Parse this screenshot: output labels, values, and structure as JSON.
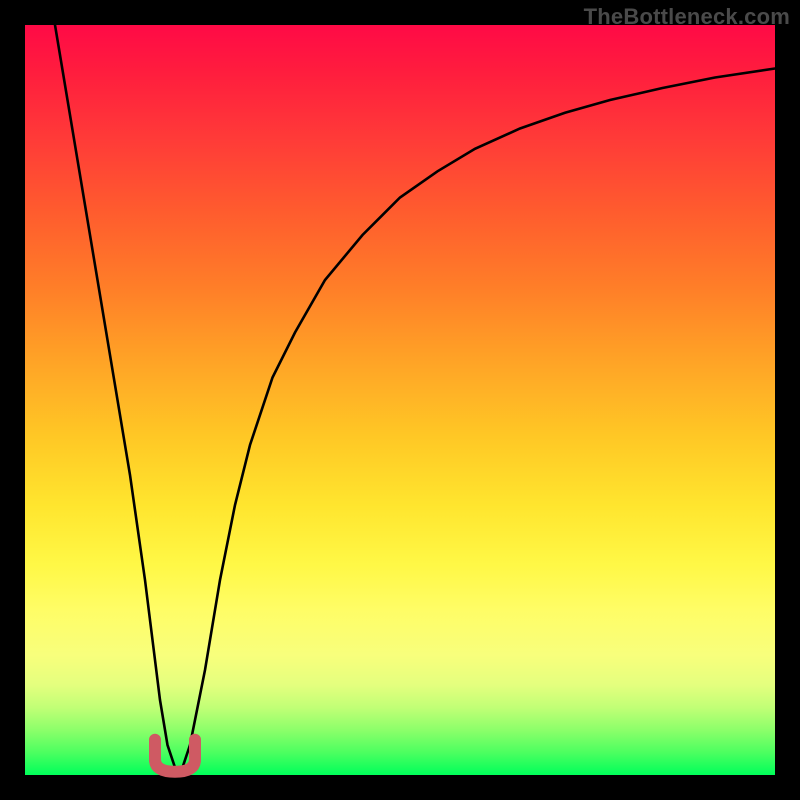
{
  "watermark": "TheBottleneck.com",
  "chart_data": {
    "type": "line",
    "title": "",
    "xlabel": "",
    "ylabel": "",
    "xlim": [
      0,
      100
    ],
    "ylim": [
      0,
      100
    ],
    "grid": false,
    "legend": null,
    "series": [
      {
        "name": "bottleneck-curve",
        "x": [
          4,
          6,
          8,
          10,
          12,
          14,
          16,
          17,
          18,
          19,
          20,
          21,
          22,
          24,
          26,
          28,
          30,
          33,
          36,
          40,
          45,
          50,
          55,
          60,
          66,
          72,
          78,
          85,
          92,
          100
        ],
        "y": [
          100,
          88,
          76,
          64,
          52,
          40,
          26,
          18,
          10,
          4,
          1,
          1,
          4,
          14,
          26,
          36,
          44,
          53,
          59,
          66,
          72,
          77,
          80.5,
          83.5,
          86.2,
          88.3,
          90,
          91.6,
          93,
          94.2
        ]
      }
    ],
    "annotations": [
      {
        "name": "valley-marker",
        "shape": "u",
        "x_center": 20,
        "y_center": 1.5,
        "color": "#cf5a63"
      }
    ],
    "background_gradient": {
      "top": "#ff0a46",
      "mid_upper": "#ff7e28",
      "mid": "#ffe52e",
      "mid_lower": "#f8ff7c",
      "bottom": "#00ff5a"
    }
  }
}
